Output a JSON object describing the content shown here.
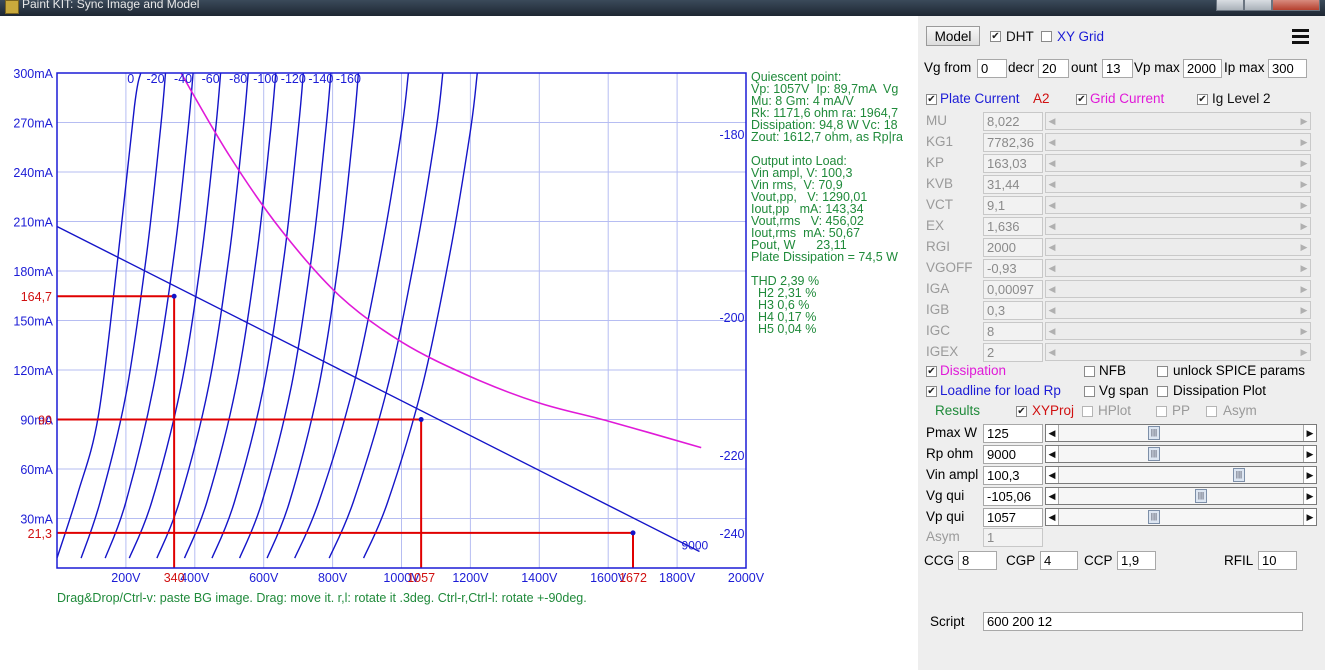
{
  "window": {
    "title": "Paint KIT: Sync Image and Model"
  },
  "chart_data": {
    "type": "line",
    "title": "",
    "xlabel": "",
    "ylabel": "",
    "xlim": [
      0,
      2000
    ],
    "ylim": [
      0,
      300
    ],
    "grid": true,
    "x_tick_labels": [
      "200V",
      "400V",
      "600V",
      "800V",
      "1000V",
      "1200V",
      "1400V",
      "1600V",
      "1800V",
      "2000V"
    ],
    "y_tick_labels": [
      "30mA",
      "60mA",
      "90mA",
      "120mA",
      "150mA",
      "180mA",
      "210mA",
      "240mA",
      "270mA",
      "300mA"
    ],
    "grid_curve_labels": [
      "0",
      "-20",
      "-40",
      "-60",
      "-80",
      "-100",
      "-120",
      "-140",
      "-160",
      "-180",
      "-200",
      "-220",
      "-240"
    ],
    "grid_curves": [
      {
        "vg": 0,
        "points": [
          [
            0,
            6
          ],
          [
            60,
            45
          ],
          [
            120,
            92
          ],
          [
            175,
            185
          ],
          [
            225,
            280
          ],
          [
            243,
            300
          ]
        ]
      },
      {
        "vg": -20,
        "points": [
          [
            70,
            6
          ],
          [
            125,
            40
          ],
          [
            200,
            105
          ],
          [
            260,
            190
          ],
          [
            300,
            265
          ],
          [
            315,
            300
          ]
        ]
      },
      {
        "vg": -40,
        "points": [
          [
            140,
            6
          ],
          [
            200,
            40
          ],
          [
            280,
            110
          ],
          [
            340,
            190
          ],
          [
            380,
            265
          ],
          [
            395,
            300
          ]
        ]
      },
      {
        "vg": -60,
        "points": [
          [
            210,
            6
          ],
          [
            275,
            40
          ],
          [
            360,
            110
          ],
          [
            420,
            190
          ],
          [
            460,
            265
          ],
          [
            475,
            300
          ]
        ]
      },
      {
        "vg": -80,
        "points": [
          [
            290,
            6
          ],
          [
            355,
            40
          ],
          [
            440,
            110
          ],
          [
            500,
            190
          ],
          [
            540,
            265
          ],
          [
            555,
            300
          ]
        ]
      },
      {
        "vg": -100,
        "points": [
          [
            370,
            6
          ],
          [
            435,
            40
          ],
          [
            520,
            110
          ],
          [
            580,
            190
          ],
          [
            620,
            265
          ],
          [
            635,
            300
          ]
        ]
      },
      {
        "vg": -120,
        "points": [
          [
            450,
            6
          ],
          [
            515,
            40
          ],
          [
            600,
            110
          ],
          [
            660,
            190
          ],
          [
            700,
            265
          ],
          [
            715,
            300
          ]
        ]
      },
      {
        "vg": -140,
        "points": [
          [
            530,
            6
          ],
          [
            595,
            40
          ],
          [
            680,
            110
          ],
          [
            740,
            190
          ],
          [
            780,
            265
          ],
          [
            795,
            300
          ]
        ]
      },
      {
        "vg": -160,
        "points": [
          [
            610,
            6
          ],
          [
            675,
            40
          ],
          [
            760,
            110
          ],
          [
            820,
            190
          ],
          [
            860,
            265
          ],
          [
            875,
            300
          ]
        ]
      },
      {
        "vg": -180,
        "points": [
          [
            690,
            6
          ],
          [
            760,
            40
          ],
          [
            860,
            110
          ],
          [
            940,
            190
          ],
          [
            1000,
            265
          ],
          [
            1020,
            300
          ]
        ]
      },
      {
        "vg": -200,
        "points": [
          [
            790,
            6
          ],
          [
            860,
            40
          ],
          [
            960,
            110
          ],
          [
            1040,
            190
          ],
          [
            1100,
            265
          ],
          [
            1120,
            300
          ]
        ]
      },
      {
        "vg": -220,
        "points": [
          [
            890,
            6
          ],
          [
            960,
            40
          ],
          [
            1060,
            110
          ],
          [
            1140,
            190
          ],
          [
            1200,
            265
          ],
          [
            1220,
            300
          ]
        ]
      }
    ],
    "loadline": {
      "points": [
        [
          0,
          207
        ],
        [
          1865,
          10
        ]
      ],
      "label": "9000"
    },
    "dissipation_curve": {
      "points": [
        [
          360,
          300
        ],
        [
          500,
          250
        ],
        [
          650,
          205
        ],
        [
          820,
          165
        ],
        [
          1000,
          137
        ],
        [
          1200,
          116
        ],
        [
          1400,
          100
        ],
        [
          1600,
          89
        ],
        [
          1870,
          73
        ]
      ]
    },
    "projections": [
      {
        "x": 340,
        "y": 164.7,
        "x_label": "340",
        "y_label": "164,7"
      },
      {
        "x": 1057,
        "y": 90,
        "x_label": "1057",
        "y_label": "90"
      },
      {
        "x": 1672,
        "y": 21.3,
        "x_label": "1672",
        "y_label": "21,3"
      }
    ],
    "text_block": [
      "Quiescent point:",
      "Vp: 1057V  Ip: 89,7mA  Vg",
      "Mu: 8 Gm: 4 mA/V",
      "Rk: 1171,6 ohm ra: 1964,7",
      "Dissipation: 94,8 W Vc: 18",
      "Zout: 1612,7 ohm, as Rp|ra",
      "",
      "Output into Load:",
      "Vin ampl, V: 100,3",
      "Vin rms,  V: 70,9",
      "Vout,pp,   V: 1290,01",
      "Iout,pp   mA: 143,34",
      "Vout,rms   V: 456,02",
      "Iout,rms  mA: 50,67",
      "Pout, W      23,11",
      "Plate Dissipation = 74,5 W",
      "",
      "THD 2,39 %",
      "  H2 2,31 %",
      "  H3 0,6 %",
      "  H4 0,17 %",
      "  H5 0,04 %"
    ]
  },
  "drag_help": "Drag&Drop/Ctrl-v: paste BG image. Drag: move it. r,l: rotate it .3deg. Ctrl-r,Ctrl-l: rotate +-90deg.",
  "panel": {
    "model_button": "Model",
    "dht_label": "DHT",
    "xygrid_label": "XY Grid",
    "vg_from_label": "Vg from",
    "vg_from": "0",
    "decr_label": "decr",
    "decr": "20",
    "count_label": "ount",
    "count": "13",
    "vpmax_label": "Vp max",
    "vpmax": "2000",
    "ipmax_label": "Ip max",
    "ipmax": "300",
    "plate_current_label": "Plate Current",
    "a2_label": "A2",
    "grid_current_label": "Grid Current",
    "ig_level_label": "Ig Level 2",
    "params": [
      {
        "name": "MU",
        "value": "8,022"
      },
      {
        "name": "KG1",
        "value": "7782,36"
      },
      {
        "name": "KP",
        "value": "163,03"
      },
      {
        "name": "KVB",
        "value": "31,44"
      },
      {
        "name": "VCT",
        "value": "9,1"
      },
      {
        "name": "EX",
        "value": "1,636"
      },
      {
        "name": "RGI",
        "value": "2000"
      },
      {
        "name": "VGOFF",
        "value": "-0,93"
      },
      {
        "name": "IGA",
        "value": "0,00097"
      },
      {
        "name": "IGB",
        "value": "0,3"
      },
      {
        "name": "IGC",
        "value": "8"
      },
      {
        "name": "IGEX",
        "value": "2"
      }
    ],
    "dissipation_label": "Dissipation",
    "nfb_label": "NFB",
    "unlock_label": "unlock SPICE params",
    "loadline_label": "Loadline for load Rp",
    "vgspan_label": "Vg span",
    "dissplot_label": "Dissipation Plot",
    "results_label": "Results",
    "xyproj_label": "XYProj",
    "hplot_label": "HPlot",
    "pp_label": "PP",
    "asym_cb_label": "Asym",
    "sliders": [
      {
        "name": "Pmax W",
        "value": "125",
        "position": 0.38
      },
      {
        "name": "Rp ohm",
        "value": "9000",
        "position": 0.38
      },
      {
        "name": "Vin ampl",
        "value": "100,3",
        "position": 0.74
      },
      {
        "name": "Vg qui",
        "value": "-105,06",
        "position": 0.58
      },
      {
        "name": "Vp qui",
        "value": "1057",
        "position": 0.38
      }
    ],
    "asym_label": "Asym",
    "asym_value": "1",
    "ccg_label": "CCG",
    "ccg": "8",
    "cgp_label": "CGP",
    "cgp": "4",
    "ccp_label": "CCP",
    "ccp": "1,9",
    "rfil_label": "RFIL",
    "rfil": "10",
    "script_label": "Script",
    "script": "600 200 12"
  }
}
